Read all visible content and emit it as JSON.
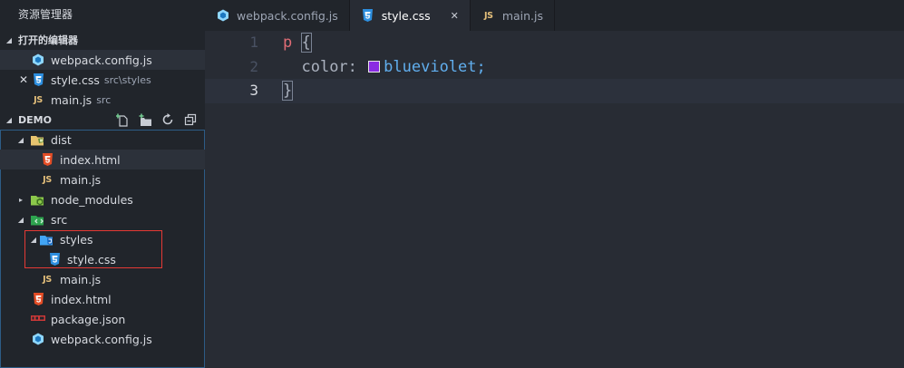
{
  "sidebar": {
    "title": "资源管理器",
    "open_editors": {
      "label": "打开的编辑器",
      "items": [
        {
          "name": "webpack.config.js",
          "desc": ""
        },
        {
          "name": "style.css",
          "desc": "src\\styles"
        },
        {
          "name": "main.js",
          "desc": "src"
        }
      ]
    },
    "project": {
      "label": "DEMO",
      "tree": [
        {
          "name": "dist"
        },
        {
          "name": "index.html"
        },
        {
          "name": "main.js"
        },
        {
          "name": "node_modules"
        },
        {
          "name": "src"
        },
        {
          "name": "styles"
        },
        {
          "name": "style.css"
        },
        {
          "name": "main.js"
        },
        {
          "name": "index.html"
        },
        {
          "name": "package.json"
        },
        {
          "name": "webpack.config.js"
        }
      ]
    }
  },
  "tabs": [
    {
      "label": "webpack.config.js",
      "active": false
    },
    {
      "label": "style.css",
      "active": true
    },
    {
      "label": "main.js",
      "active": false
    }
  ],
  "editor": {
    "line_numbers": [
      "1",
      "2",
      "3"
    ],
    "selector": "p",
    "open_brace": "{",
    "property": "color:",
    "value": "blueviolet;",
    "close_brace": "}",
    "swatch_color": "#8a2be2"
  },
  "icon_labels": {
    "js": "JS"
  },
  "colors": {
    "sidebar_bg": "#21252b",
    "editor_bg": "#282c34",
    "selection_outline": "#e53935",
    "swatch": "#8a2be2"
  }
}
